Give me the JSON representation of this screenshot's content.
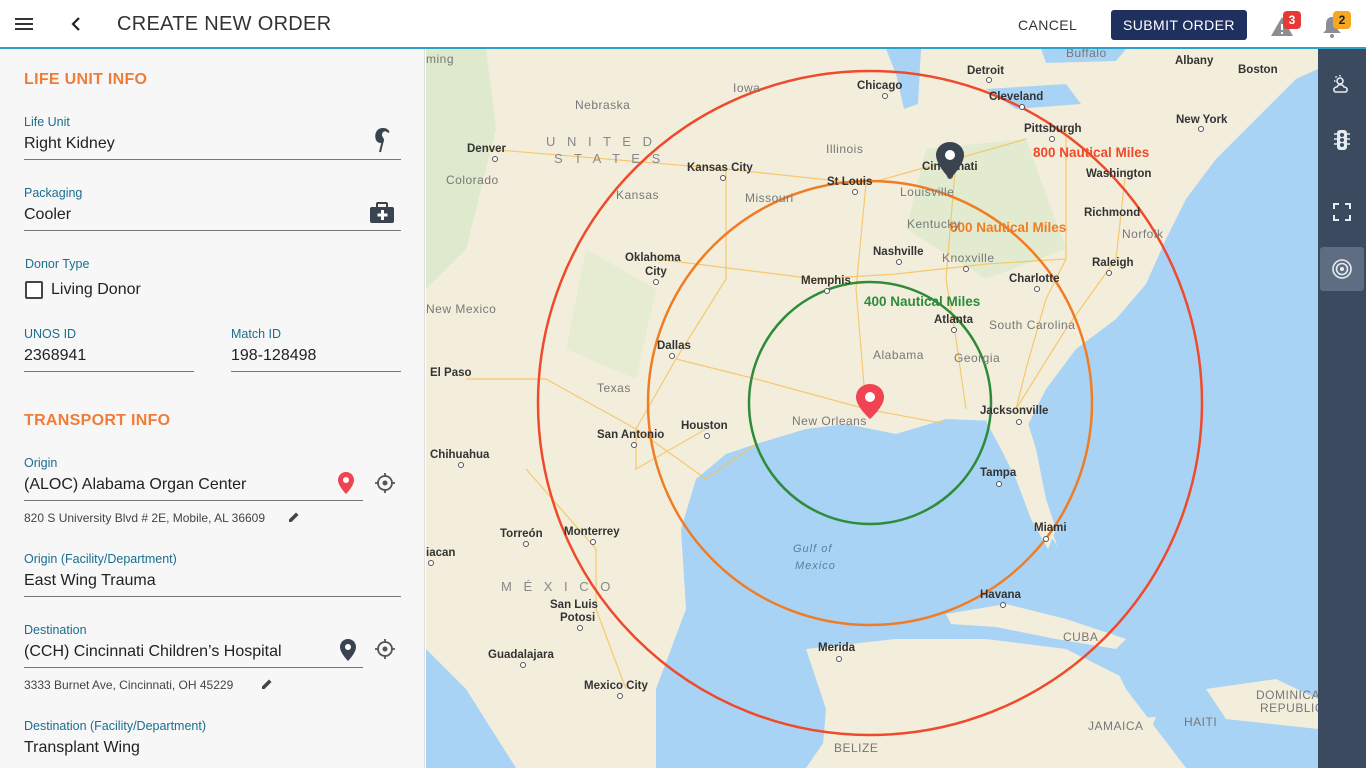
{
  "header": {
    "title": "CREATE NEW ORDER",
    "cancel_label": "CANCEL",
    "submit_label": "SUBMIT ORDER",
    "alerts_count": "3",
    "notifications_count": "2"
  },
  "life_unit_info": {
    "heading": "LIFE UNIT INFO",
    "life_unit_label": "Life Unit",
    "life_unit_value": "Right Kidney",
    "packaging_label": "Packaging",
    "packaging_value": "Cooler",
    "donor_type_label": "Donor Type",
    "living_donor_label": "Living Donor",
    "living_donor_checked": false,
    "unos_label": "UNOS ID",
    "unos_value": "2368941",
    "match_label": "Match ID",
    "match_value": "198-128498"
  },
  "transport_info": {
    "heading": "TRANSPORT INFO",
    "origin_label": "Origin",
    "origin_value": "(ALOC) Alabama Organ Center",
    "origin_address": "820 S University Blvd # 2E, Mobile, AL 36609",
    "origin_dept_label": "Origin (Facility/Department)",
    "origin_dept_value": "East Wing Trauma",
    "destination_label": "Destination",
    "destination_value": "(CCH) Cincinnati Children’s Hospital",
    "destination_address": "3333 Burnet Ave, Cincinnati, OH 45229",
    "destination_dept_label": "Destination (Facility/Department)",
    "destination_dept_value": "Transplant Wing"
  },
  "map": {
    "rings": [
      {
        "label": "400 Nautical Miles",
        "color": "#2e8b3a"
      },
      {
        "label": "600 Nautical Miles",
        "color": "#f07c24"
      },
      {
        "label": "800 Nautical Miles",
        "color": "#ee4a2b"
      }
    ],
    "origin_pin_color": "#f04452",
    "destination_pin_color": "#3a4350",
    "place_labels": [
      "Chicago",
      "Detroit",
      "Cleveland",
      "Buffalo",
      "Albany",
      "Boston",
      "Pittsburgh",
      "New York",
      "Cincinnati",
      "Washington",
      "Richmond",
      "Norfolk",
      "Denver",
      "Colorado",
      "Nebraska",
      "Iowa",
      "Illinois",
      "Kansas City",
      "Kansas",
      "Missouri",
      "St Louis",
      "Louisville",
      "Kentucky",
      "Oklahoma",
      "City",
      "Memphis",
      "Nashville",
      "Knoxville",
      "Charlotte",
      "Raleigh",
      "New Mexico",
      "Dallas",
      "Atlanta",
      "South Carolina",
      "Alabama",
      "Georgia",
      "El Paso",
      "Texas",
      "Jacksonville",
      "New Orleans",
      "San Antonio",
      "Houston",
      "Chihuahua",
      "Tampa",
      "Miami",
      "Torreón",
      "Monterrey",
      "iacan",
      "San Luis",
      "Potosi",
      "Havana",
      "CUBA",
      "Guadalajara",
      "Merida",
      "Mexico City",
      "BELIZE",
      "JAMAICA",
      "HAITI",
      "DOMINICAN",
      "REPUBLIC",
      "ming"
    ],
    "country_labels": [
      "U N I T E D",
      "S T A T E S",
      "M É X I C O"
    ],
    "water_labels": [
      "Gulf of",
      "Mexico"
    ]
  },
  "rail": {
    "icons": [
      "weather-icon",
      "traffic-icon",
      "fullscreen-icon",
      "radius-icon"
    ],
    "active": "radius-icon"
  }
}
